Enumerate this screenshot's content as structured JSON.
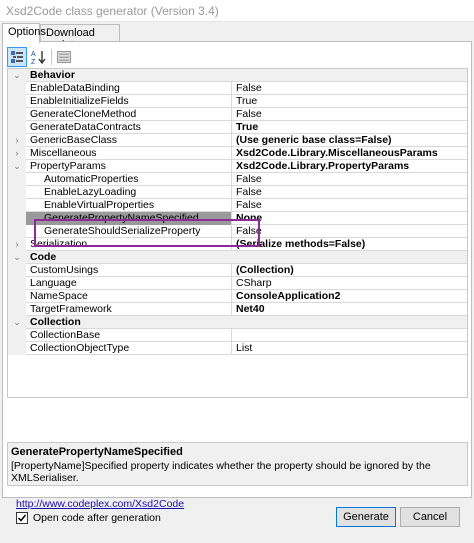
{
  "window": {
    "title": "Xsd2Code class generator (Version 3.4)"
  },
  "tabs": [
    {
      "label": "Options"
    },
    {
      "label": "Download update"
    }
  ],
  "toolbar": {
    "categorized_icon": "categorized-icon",
    "alphabetical_icon": "sort-alphabetical-icon",
    "pages_icon": "property-pages-icon"
  },
  "grid": {
    "rows": [
      {
        "kind": "category",
        "expand": "v",
        "name": "Behavior"
      },
      {
        "kind": "prop",
        "name": "EnableDataBinding",
        "value": "False"
      },
      {
        "kind": "prop",
        "name": "EnableInitializeFields",
        "value": "True"
      },
      {
        "kind": "prop",
        "name": "GenerateCloneMethod",
        "value": "False"
      },
      {
        "kind": "prop",
        "name": "GenerateDataContracts",
        "value": "True",
        "bold": true
      },
      {
        "kind": "prop",
        "expand": ">",
        "name": "GenericBaseClass",
        "value": "(Use generic base class=False)",
        "bold": true
      },
      {
        "kind": "prop",
        "expand": ">",
        "name": "Miscellaneous",
        "value": "Xsd2Code.Library.MiscellaneousParams",
        "bold": true
      },
      {
        "kind": "prop",
        "expand": "v",
        "name": "PropertyParams",
        "value": "Xsd2Code.Library.PropertyParams",
        "bold": true
      },
      {
        "kind": "sub",
        "name": "AutomaticProperties",
        "value": "False"
      },
      {
        "kind": "sub",
        "name": "EnableLazyLoading",
        "value": "False"
      },
      {
        "kind": "sub",
        "name": "EnableVirtualProperties",
        "value": "False"
      },
      {
        "kind": "sub",
        "name": "GeneratePropertyNameSpecified",
        "value": "None",
        "selected": true
      },
      {
        "kind": "sub",
        "name": "GenerateShouldSerializeProperty",
        "value": "False"
      },
      {
        "kind": "prop",
        "expand": ">",
        "name": "Serialization",
        "value": "(Serialize methods=False)",
        "bold": true
      },
      {
        "kind": "category",
        "expand": "v",
        "name": "Code"
      },
      {
        "kind": "prop",
        "name": "CustomUsings",
        "value": "(Collection)",
        "bold": true
      },
      {
        "kind": "prop",
        "name": "Language",
        "value": "CSharp"
      },
      {
        "kind": "prop",
        "name": "NameSpace",
        "value": "ConsoleApplication2",
        "bold": true
      },
      {
        "kind": "prop",
        "name": "TargetFramework",
        "value": "Net40",
        "bold": true
      },
      {
        "kind": "category",
        "expand": "v",
        "name": "Collection"
      },
      {
        "kind": "prop",
        "name": "CollectionBase",
        "value": ""
      },
      {
        "kind": "prop",
        "name": "CollectionObjectType",
        "value": "List"
      }
    ]
  },
  "description": {
    "title": "GeneratePropertyNameSpecified",
    "text": "[PropertyName]Specified property indicates whether the property should be ignored by the XMLSerialiser."
  },
  "footer": {
    "link": "http://www.codeplex.com/Xsd2Code",
    "checkbox_label": "Open code after generation",
    "checkbox_checked": true,
    "generate_label": "Generate",
    "cancel_label": "Cancel"
  },
  "colors": {
    "highlight_border": "#8e2a97",
    "selection": "#9a9a9a"
  }
}
